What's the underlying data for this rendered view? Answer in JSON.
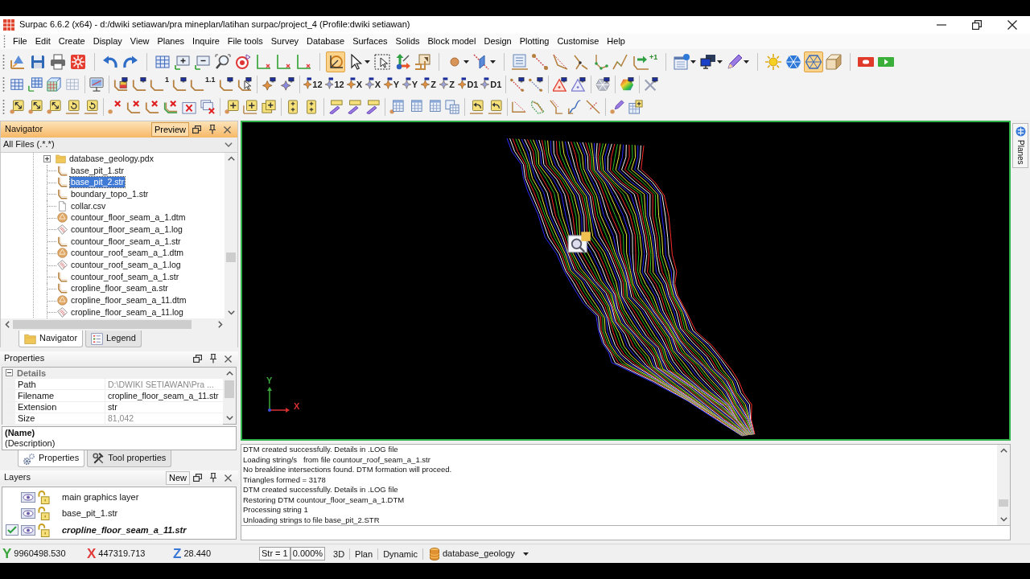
{
  "window": {
    "title": "Surpac 6.6.2 (x64) - d:/dwiki setiawan/pra mineplan/latihan surpac/project_4 (Profile:dwiki setiawan)"
  },
  "menu": [
    "File",
    "Edit",
    "Create",
    "Display",
    "View",
    "Planes",
    "Inquire",
    "File tools",
    "Survey",
    "Database",
    "Surfaces",
    "Solids",
    "Block model",
    "Design",
    "Plotting",
    "Customise",
    "Help"
  ],
  "toolbars": [
    {
      "buttons": [
        {
          "pressed": false
        },
        {
          "pressed": false
        },
        {
          "pressed": false
        },
        {
          "pressed": false
        },
        {
          "pressed": false
        },
        {
          "pressed": false
        },
        {
          "pressed": false
        },
        {
          "pressed": false
        },
        {
          "pressed": false
        },
        {
          "pressed": false
        },
        {
          "pressed": false
        },
        {
          "pressed": false
        },
        {
          "pressed": false
        },
        {
          "pressed": false
        },
        {
          "pressed": true
        },
        {
          "pressed": false
        },
        {
          "pressed": false
        },
        {
          "pressed": false
        },
        {
          "pressed": false
        },
        {
          "pressed": false
        },
        {
          "pressed": false
        },
        {
          "pressed": false
        },
        {
          "pressed": false
        },
        {
          "pressed": false
        },
        {
          "pressed": false
        },
        {
          "pressed": false
        },
        {
          "pressed": false
        },
        {
          "pressed": false,
          "label": "+1"
        },
        {
          "pressed": false
        },
        {
          "pressed": false
        },
        {
          "pressed": false
        },
        {
          "pressed": false
        },
        {
          "pressed": false
        },
        {
          "pressed": true
        },
        {
          "pressed": false
        },
        {
          "pressed": false
        },
        {
          "pressed": false
        }
      ]
    },
    {
      "buttons": [
        {
          "pressed": false
        },
        {
          "pressed": false
        },
        {
          "pressed": false
        },
        {
          "pressed": false
        },
        {
          "pressed": false
        },
        {
          "pressed": false
        },
        {
          "pressed": false
        },
        {
          "pressed": false,
          "label": "1"
        },
        {
          "pressed": false
        },
        {
          "pressed": false,
          "label": "1.1"
        },
        {
          "pressed": false
        },
        {
          "pressed": false
        },
        {
          "pressed": false
        },
        {
          "pressed": false
        },
        {
          "pressed": false,
          "label": "12"
        },
        {
          "pressed": false,
          "label": "12"
        },
        {
          "pressed": false,
          "label": "X"
        },
        {
          "pressed": false,
          "label": "X"
        },
        {
          "pressed": false,
          "label": "Y"
        },
        {
          "pressed": false,
          "label": "Y"
        },
        {
          "pressed": false,
          "label": "Z"
        },
        {
          "pressed": false,
          "label": "Z"
        },
        {
          "pressed": false,
          "label": "D1"
        },
        {
          "pressed": false,
          "label": "D1"
        },
        {
          "pressed": false
        },
        {
          "pressed": false
        },
        {
          "pressed": false
        },
        {
          "pressed": false
        },
        {
          "pressed": false
        },
        {
          "pressed": false
        },
        {
          "pressed": false
        }
      ]
    },
    {
      "buttons": [
        {
          "pressed": false
        },
        {
          "pressed": false
        },
        {
          "pressed": false
        },
        {
          "pressed": false
        },
        {
          "pressed": false
        },
        {
          "pressed": false
        },
        {
          "pressed": false
        },
        {
          "pressed": false
        },
        {
          "pressed": false
        },
        {
          "pressed": false
        },
        {
          "pressed": false
        },
        {
          "pressed": false
        },
        {
          "pressed": false
        },
        {
          "pressed": false
        },
        {
          "pressed": false
        },
        {
          "pressed": false
        },
        {
          "pressed": false
        },
        {
          "pressed": false
        },
        {
          "pressed": false
        },
        {
          "pressed": false
        },
        {
          "pressed": false
        },
        {
          "pressed": false
        },
        {
          "pressed": false
        },
        {
          "pressed": false
        },
        {
          "pressed": false
        },
        {
          "pressed": false
        },
        {
          "pressed": false
        },
        {
          "pressed": false
        },
        {
          "pressed": false
        },
        {
          "pressed": false
        },
        {
          "pressed": false
        },
        {
          "pressed": false
        }
      ]
    }
  ],
  "navigator": {
    "title": "Navigator",
    "preview_button": "Preview",
    "filter": "All Files (.*.*)",
    "tree": [
      {
        "label": "database_geology.pdx",
        "kind": "folder",
        "expanded": false,
        "selected": false
      },
      {
        "label": "base_pit_1.str",
        "kind": "string",
        "selected": false
      },
      {
        "label": "base_pit_2.str",
        "kind": "string",
        "selected": true
      },
      {
        "label": "boundary_topo_1.str",
        "kind": "string",
        "selected": false
      },
      {
        "label": "collar.csv",
        "kind": "csv",
        "selected": false
      },
      {
        "label": "countour_floor_seam_a_1.dtm",
        "kind": "dtm",
        "selected": false
      },
      {
        "label": "countour_floor_seam_a_1.log",
        "kind": "log",
        "selected": false
      },
      {
        "label": "countour_floor_seam_a_1.str",
        "kind": "string",
        "selected": false
      },
      {
        "label": "countour_roof_seam_a_1.dtm",
        "kind": "dtm",
        "selected": false
      },
      {
        "label": "countour_roof_seam_a_1.log",
        "kind": "log",
        "selected": false
      },
      {
        "label": "countour_roof_seam_a_1.str",
        "kind": "string",
        "selected": false
      },
      {
        "label": "cropline_floor_seam_a.str",
        "kind": "string",
        "selected": false
      },
      {
        "label": "cropline_floor_seam_a_11.dtm",
        "kind": "dtm",
        "selected": false
      },
      {
        "label": "cropline_floor_seam_a_11.log",
        "kind": "log",
        "selected": false
      }
    ],
    "tabs": [
      {
        "label": "Navigator",
        "selected": true
      },
      {
        "label": "Legend",
        "selected": false
      }
    ]
  },
  "properties": {
    "title": "Properties",
    "category": {
      "label": "Details",
      "expanded": true
    },
    "rows": [
      {
        "name": "Path",
        "value": "D:\\DWIKI SETIAWAN\\Pra ...",
        "disabled": true
      },
      {
        "name": "Filename",
        "value": "cropline_floor_seam_a_11.str",
        "disabled": false
      },
      {
        "name": "Extension",
        "value": "str",
        "disabled": false
      },
      {
        "name": "Size",
        "value": "81,042",
        "disabled": true
      }
    ],
    "name_label": "(Name)",
    "description": "(Description)",
    "tabs": [
      {
        "label": "Properties",
        "selected": true
      },
      {
        "label": "Tool properties",
        "selected": false
      }
    ]
  },
  "layers": {
    "title": "Layers",
    "new_button": "New",
    "items": [
      {
        "label": "main graphics layer",
        "active": false
      },
      {
        "label": "base_pit_1.str",
        "active": false
      },
      {
        "label": "cropline_floor_seam_a_11.str",
        "active": true
      }
    ]
  },
  "viewport": {
    "axis_labels": [
      {
        "text": "Y",
        "color": "#3aa53a"
      },
      {
        "text": "X",
        "color": "#d83030"
      }
    ]
  },
  "side_tab": {
    "label": "Planes"
  },
  "log": {
    "lines": [
      "DTM created successfully. Details in .LOG file",
      "Loading string/s   from file countour_roof_seam_a_1.str",
      "No breakline intersections found. DTM formation will proceed.",
      "Triangles formed = 3178",
      "DTM created successfully. Details in .LOG file",
      "Restoring DTM countour_floor_seam_a_1.DTM",
      "Processing string 1",
      "Unloading strings to file base_pit_2.STR"
    ]
  },
  "status_bar": {
    "coordinates": [
      {
        "axis": "Y",
        "value": "9960498.530",
        "color": "#3aa53a"
      },
      {
        "axis": "X",
        "value": "447319.713",
        "color": "#e03c3c"
      },
      {
        "axis": "Z",
        "value": "28.440",
        "color": "#3a78d8"
      }
    ],
    "string": "Str = 1",
    "percent": "0.000%",
    "modes": [
      "3D",
      "Plan",
      "Dynamic"
    ],
    "database": "database_geology"
  }
}
